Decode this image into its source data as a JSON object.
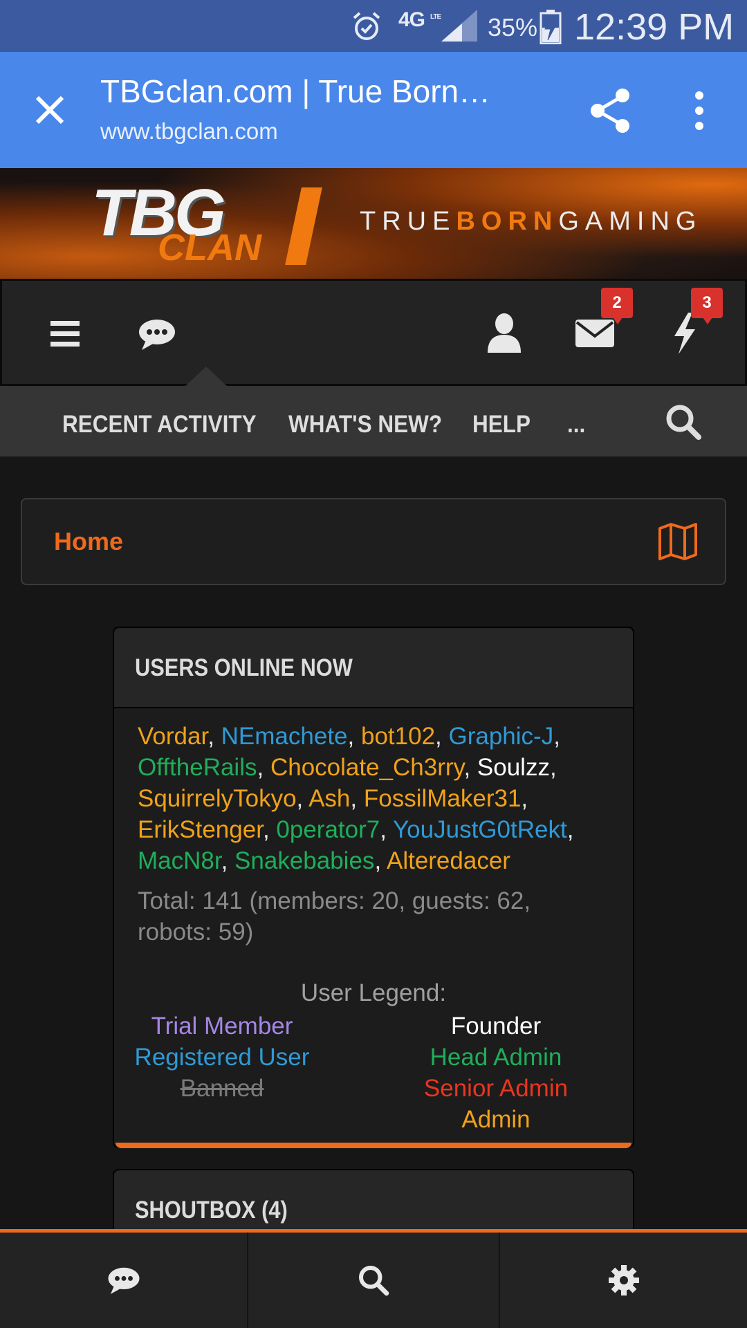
{
  "status_bar": {
    "network": "4G",
    "network_sub": "LTE",
    "battery_percent": "35%",
    "time": "12:39 PM",
    "icons": [
      "alarm-icon",
      "signal-icon",
      "battery-charging-icon"
    ]
  },
  "browser": {
    "title": "TBGclan.com | True Born…",
    "url": "www.tbgclan.com",
    "icons": [
      "close-icon",
      "share-icon",
      "more-vert-icon"
    ]
  },
  "banner": {
    "logo_top": "TBG",
    "logo_bottom": "CLAN",
    "tagline_pre": "TRUE",
    "tagline_mid": "BORN",
    "tagline_post": "GAMING"
  },
  "forum_nav": {
    "icons": [
      "menu-icon",
      "chat-bubble-icon",
      "user-icon",
      "envelope-icon",
      "bolt-icon"
    ],
    "inbox_count": "2",
    "alerts_count": "3"
  },
  "subnav": {
    "items": [
      "RECENT ACTIVITY",
      "WHAT'S NEW?",
      "HELP",
      "..."
    ]
  },
  "breadcrumb": {
    "home": "Home"
  },
  "online": {
    "title": "USERS ONLINE NOW",
    "users": [
      {
        "name": "Vordar",
        "role": "admin"
      },
      {
        "name": "NEmachete",
        "role": "registered"
      },
      {
        "name": "bot102",
        "role": "admin"
      },
      {
        "name": "Graphic-J",
        "role": "registered"
      },
      {
        "name": "OfftheRails",
        "role": "head"
      },
      {
        "name": "Chocolate_Ch3rry",
        "role": "admin"
      },
      {
        "name": "Soulzz",
        "role": "founder"
      },
      {
        "name": "SquirrelyTokyo",
        "role": "admin"
      },
      {
        "name": "Ash",
        "role": "admin"
      },
      {
        "name": "FossilMaker31",
        "role": "admin"
      },
      {
        "name": "ErikStenger",
        "role": "admin"
      },
      {
        "name": "0perator7",
        "role": "head"
      },
      {
        "name": "YouJustG0tRekt",
        "role": "registered"
      },
      {
        "name": "MacN8r",
        "role": "head"
      },
      {
        "name": "Snakebabies",
        "role": "head"
      },
      {
        "name": "Alteredacer",
        "role": "admin"
      }
    ],
    "totals_line1": "Total: 141 (members: 20, guests: 62,",
    "totals_line2": "robots: 59)",
    "legend_title": "User Legend:",
    "legend_left": [
      "Trial Member",
      "Registered User",
      "Banned"
    ],
    "legend_right": [
      "Founder",
      "Head Admin",
      "Senior Admin",
      "Admin"
    ]
  },
  "shoutbox": {
    "title": "SHOUTBOX (4)"
  },
  "bottom_bar": {
    "icons": [
      "chat-bubble-icon",
      "search-icon",
      "gear-icon"
    ]
  },
  "colors": {
    "accent": "#ee6a1c",
    "browser_bar": "#4a87ea",
    "status_bar": "#3c5aa0",
    "admin": "#f0a21a",
    "registered": "#2f9ad6",
    "head_admin": "#1fae5a",
    "senior_admin": "#e8361f",
    "trial": "#a586e6",
    "badge": "#d9312b"
  }
}
